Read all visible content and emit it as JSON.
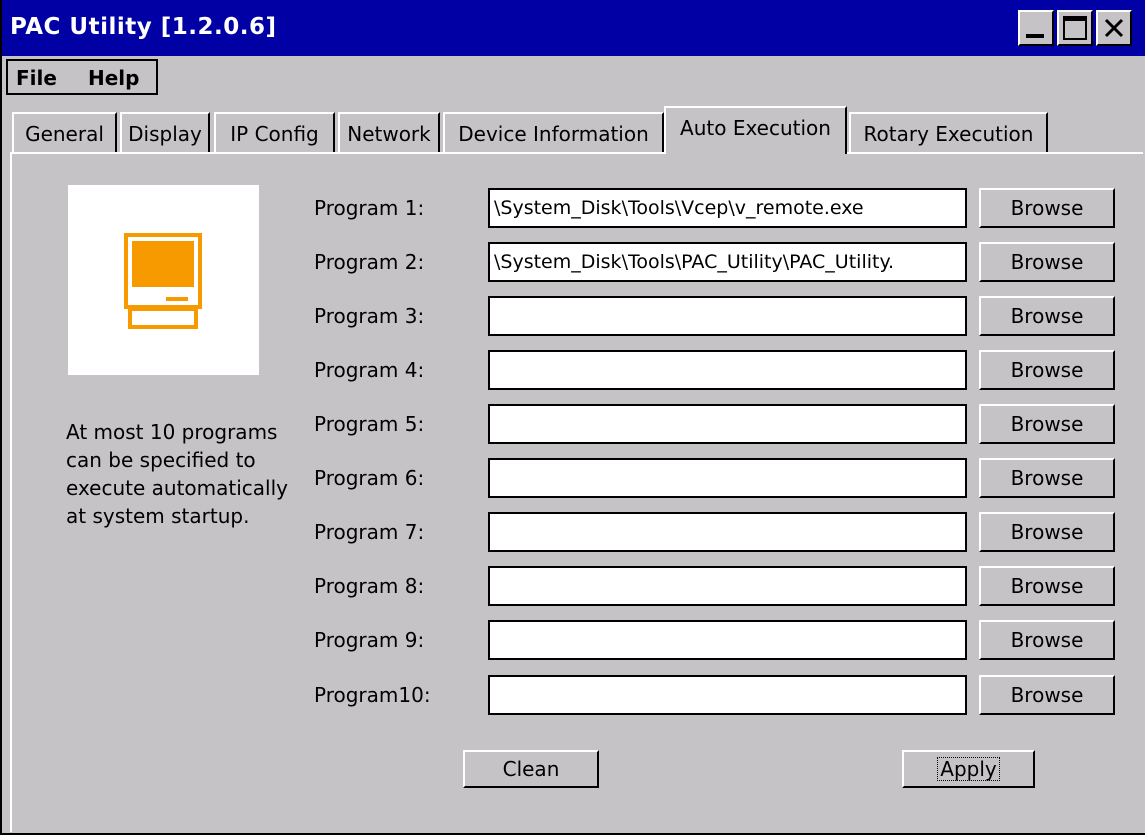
{
  "window": {
    "title": "PAC Utility  [1.2.0.6]"
  },
  "titlebar_buttons": {
    "minimize": "minimize-icon",
    "maximize": "maximize-icon",
    "close": "close-icon"
  },
  "menu": {
    "file": "File",
    "help": "Help"
  },
  "tabs": [
    {
      "label": "General"
    },
    {
      "label": "Display"
    },
    {
      "label": "IP Config"
    },
    {
      "label": "Network"
    },
    {
      "label": "Device Information"
    },
    {
      "label": "Auto Execution",
      "active": true
    },
    {
      "label": "Rotary Execution"
    }
  ],
  "icon": {
    "name": "computer-icon",
    "color": "#f79a00"
  },
  "note": "At most 10 programs can be specified to execute automatically at system startup.",
  "programs": [
    {
      "label": "Program 1:",
      "value": "\\System_Disk\\Tools\\Vcep\\v_remote.exe",
      "browse": "Browse"
    },
    {
      "label": "Program 2:",
      "value": "\\System_Disk\\Tools\\PAC_Utility\\PAC_Utility.",
      "browse": "Browse"
    },
    {
      "label": "Program 3:",
      "value": "",
      "browse": "Browse"
    },
    {
      "label": "Program 4:",
      "value": "",
      "browse": "Browse"
    },
    {
      "label": "Program 5:",
      "value": "",
      "browse": "Browse"
    },
    {
      "label": "Program 6:",
      "value": "",
      "browse": "Browse"
    },
    {
      "label": "Program 7:",
      "value": "",
      "browse": "Browse"
    },
    {
      "label": "Program 8:",
      "value": "",
      "browse": "Browse"
    },
    {
      "label": "Program 9:",
      "value": "",
      "browse": "Browse"
    },
    {
      "label": "Program10:",
      "value": "",
      "browse": "Browse"
    }
  ],
  "actions": {
    "clean": "Clean",
    "apply": "Apply"
  },
  "colors": {
    "titlebar": "#0000a5",
    "face": "#c6c3c6"
  }
}
